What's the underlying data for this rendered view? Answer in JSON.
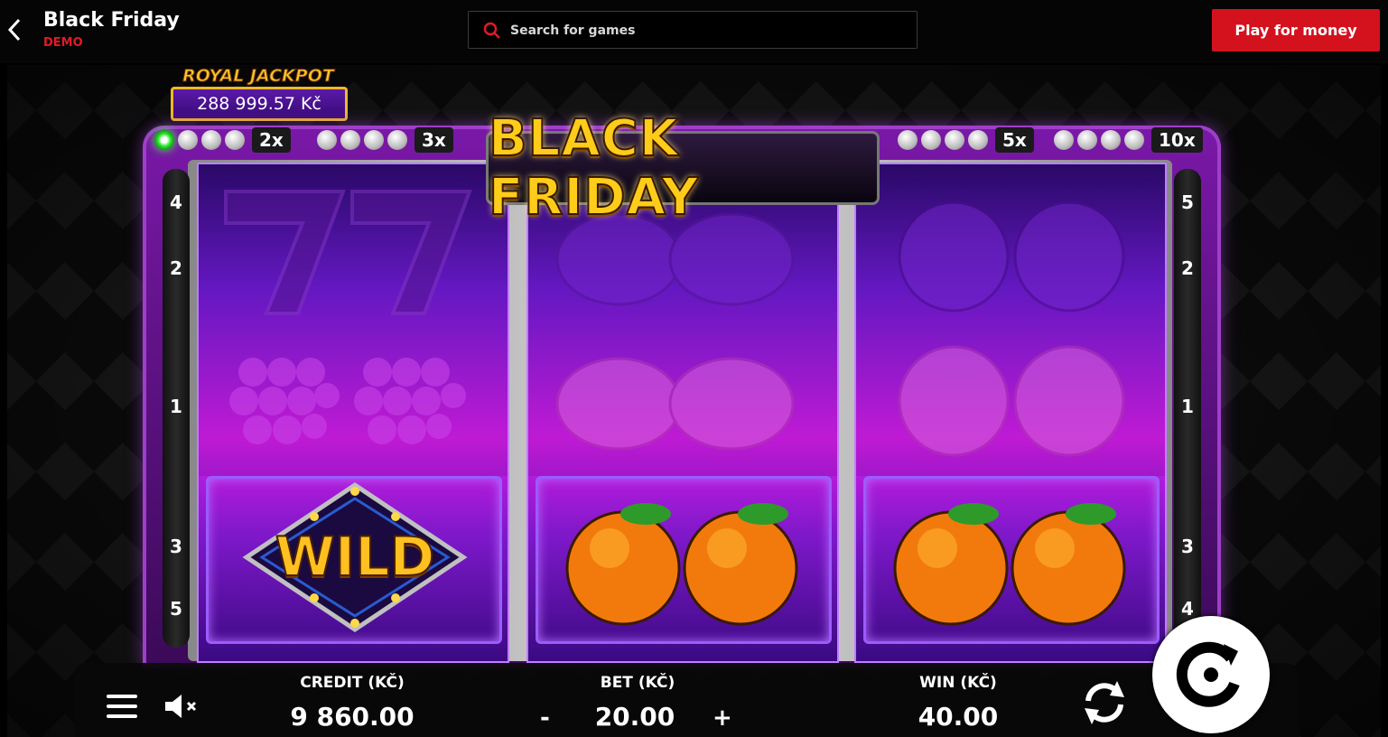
{
  "header": {
    "title": "Black Friday",
    "badge": "DEMO",
    "search_placeholder": "Search for games",
    "play_label": "Play for money"
  },
  "colors": {
    "accent_red": "#d4121e",
    "reel_purple": "#6c1cd1",
    "reel_magenta": "#d41ee6",
    "gold": "#ffcc1a",
    "multiplier_active": "#29e62b"
  },
  "jackpot": {
    "title": "ROYAL JACKPOT",
    "value": "288 999.57 Kč"
  },
  "game_logo": "BLACK FRIDAY",
  "multipliers": [
    {
      "label": "2x",
      "dots": 4,
      "active_dots": 1
    },
    {
      "label": "3x",
      "dots": 4,
      "active_dots": 0
    },
    {
      "label": "5x",
      "dots": 4,
      "active_dots": 0
    },
    {
      "label": "10x",
      "dots": 4,
      "active_dots": 0
    }
  ],
  "paylines_left": [
    "4",
    "2",
    "1",
    "3",
    "5"
  ],
  "paylines_right": [
    "5",
    "2",
    "1",
    "3",
    "4"
  ],
  "reels": [
    {
      "top": "seven-icon",
      "middle": "grapes-icon",
      "bottom": "wild-icon",
      "bottom_text": "WILD"
    },
    {
      "top": "lemon-icon",
      "middle": "lemon-icon",
      "bottom": "orange-icon"
    },
    {
      "top": "orange-icon",
      "middle": "orange-icon",
      "bottom": "orange-icon"
    }
  ],
  "bottom": {
    "credit_label": "CREDIT (KČ)",
    "credit_value": "9 860.00",
    "bet_label": "BET (KČ)",
    "bet_value": "20.00",
    "bet_minus": "-",
    "bet_plus": "+",
    "win_label": "WIN (KČ)",
    "win_value": "40.00"
  }
}
